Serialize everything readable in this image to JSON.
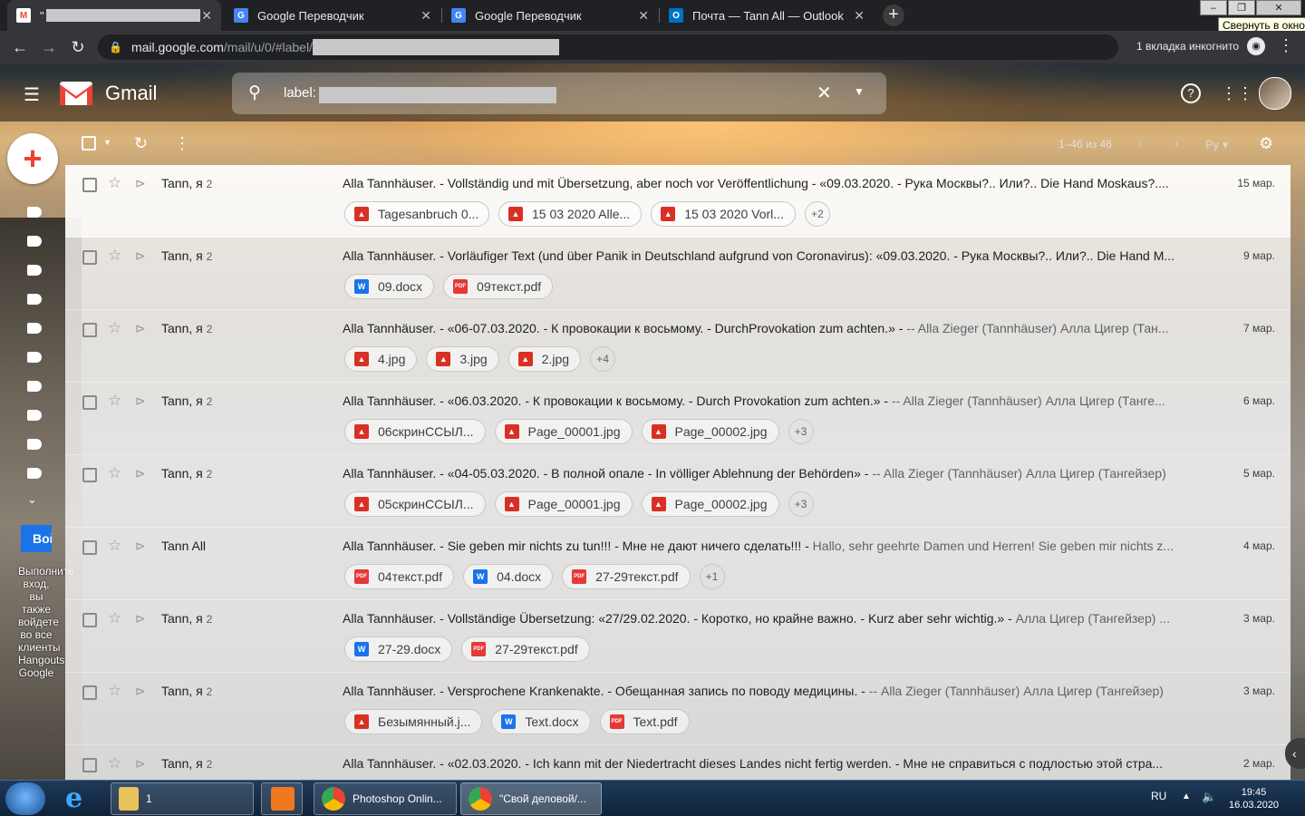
{
  "browser": {
    "tabs": [
      {
        "title": "\"",
        "redacted": true,
        "active": true,
        "favicon": "gmail-icon"
      },
      {
        "title": "Google Переводчик",
        "favicon": "google-translate-icon"
      },
      {
        "title": "Google Переводчик",
        "favicon": "google-translate-icon"
      },
      {
        "title": "Почта — Tann All — Outlook",
        "favicon": "outlook-icon"
      }
    ],
    "window_tooltip": "Свернуть в окно",
    "url_host": "mail.google.com",
    "url_path": "/mail/u/0/#label/",
    "incognito_label": "1 вкладка инкогнито"
  },
  "gmail": {
    "brand": "Gmail",
    "search_value": "label:",
    "pager_text": "1–46 из 46",
    "lang_button": "Ру",
    "hangouts": {
      "button_label": "Вой",
      "text": "Выполните вход, вы также войдете во все клиенты Hangouts Google"
    }
  },
  "emails": [
    {
      "sender": "Tann, я",
      "count": "2",
      "subject": "Alla Tannhäuser. - Vollständig und mit Übersetzung, aber noch vor Veröffentlichung - «09.03.2020. - Рука Москвы?.. Или?.. Die Hand Moskaus?....",
      "snippet": "",
      "date": "15 мар.",
      "attachments": [
        {
          "type": "img",
          "name": "Tagesanbruch 0..."
        },
        {
          "type": "img",
          "name": "15 03 2020 Alle..."
        },
        {
          "type": "img",
          "name": "15 03 2020 Vorl..."
        }
      ],
      "more": "+2"
    },
    {
      "sender": "Tann, я",
      "count": "2",
      "subject": "Alla Tannhäuser. - Vorläufiger Text (und über Panik in Deutschland aufgrund von Coronavirus): «09.03.2020. - Рука Москвы?.. Или?.. Die Hand M...",
      "snippet": "",
      "date": "9 мар.",
      "attachments": [
        {
          "type": "doc",
          "name": "09.docx"
        },
        {
          "type": "pdf",
          "name": "09текст.pdf"
        }
      ],
      "more": ""
    },
    {
      "sender": "Tann, я",
      "count": "2",
      "subject": "Alla Tannhäuser. - «06-07.03.2020. - К провокации к восьмому. - DurchProvokation zum achten.» - ",
      "snippet": "-- Alla Zieger (Tannhäuser) Алла Цигер (Тан...",
      "date": "7 мар.",
      "attachments": [
        {
          "type": "img",
          "name": "4.jpg"
        },
        {
          "type": "img",
          "name": "3.jpg"
        },
        {
          "type": "img",
          "name": "2.jpg"
        }
      ],
      "more": "+4"
    },
    {
      "sender": "Tann, я",
      "count": "2",
      "subject": "Alla Tannhäuser. - «06.03.2020. - К провокации к восьмому. - Durch Provokation zum achten.» - ",
      "snippet": "-- Alla Zieger (Tannhäuser) Алла Цигер (Танге...",
      "date": "6 мар.",
      "attachments": [
        {
          "type": "img",
          "name": "06скринССЫЛ..."
        },
        {
          "type": "img",
          "name": "Page_00001.jpg"
        },
        {
          "type": "img",
          "name": "Page_00002.jpg"
        }
      ],
      "more": "+3"
    },
    {
      "sender": "Tann, я",
      "count": "2",
      "subject": "Alla Tannhäuser. - «04-05.03.2020. - В полной опале - In völliger Ablehnung der Behörden» - ",
      "snippet": "-- Alla Zieger (Tannhäuser) Алла Цигер (Тангейзер)",
      "date": "5 мар.",
      "attachments": [
        {
          "type": "img",
          "name": "05скринССЫЛ..."
        },
        {
          "type": "img",
          "name": "Page_00001.jpg"
        },
        {
          "type": "img",
          "name": "Page_00002.jpg"
        }
      ],
      "more": "+3"
    },
    {
      "sender": "Tann All",
      "count": "",
      "subject": "Alla Tannhäuser. - Sie geben mir nichts zu tun!!! - Мне не дают ничего сделать!!! - ",
      "snippet": "Hallo, sehr geehrte Damen und Herren! Sie geben mir nichts z...",
      "date": "4 мар.",
      "attachments": [
        {
          "type": "pdf",
          "name": "04текст.pdf"
        },
        {
          "type": "doc",
          "name": "04.docx"
        },
        {
          "type": "pdf",
          "name": "27-29текст.pdf"
        }
      ],
      "more": "+1"
    },
    {
      "sender": "Tann, я",
      "count": "2",
      "subject": "Alla Tannhäuser. - Vollständige Übersetzung: «27/29.02.2020. - Коротко, но крайне важно. - Kurz aber sehr wichtig.» - ",
      "snippet": "Алла Цигер (Тангейзер) ...",
      "date": "3 мар.",
      "attachments": [
        {
          "type": "doc",
          "name": "27-29.docx"
        },
        {
          "type": "pdf",
          "name": "27-29текст.pdf"
        }
      ],
      "more": ""
    },
    {
      "sender": "Tann, я",
      "count": "2",
      "subject": "Alla Tannhäuser. - Versprochene Krankenakte. - Обещанная запись по поводу медицины. - ",
      "snippet": "-- Alla Zieger (Tannhäuser) Алла Цигер (Тангейзер)",
      "date": "3 мар.",
      "attachments": [
        {
          "type": "img",
          "name": "Безымянный.j..."
        },
        {
          "type": "doc",
          "name": "Text.docx"
        },
        {
          "type": "pdf",
          "name": "Text.pdf"
        }
      ],
      "more": ""
    },
    {
      "sender": "Tann, я",
      "count": "2",
      "subject": "Alla Tannhäuser. - «02.03.2020. - Ich kann mit der Niedertracht dieses Landes nicht fertig werden. - Мне не справиться с подлостью этой стра...",
      "snippet": "",
      "date": "2 мар.",
      "attachments": [],
      "more": ""
    }
  ],
  "taskbar": {
    "items": [
      {
        "label": "1",
        "icon": "folder-icon"
      },
      {
        "label": "",
        "icon": "media-player-icon"
      },
      {
        "label": "Photoshop Onlin...",
        "icon": "chrome-icon"
      },
      {
        "label": "\"Свой деловой/...",
        "icon": "chrome-icon"
      }
    ],
    "lang": "RU",
    "time": "19:45",
    "date": "16.03.2020"
  },
  "colors": {
    "accent": "#1a73e8",
    "gmail_red": "#ea4335",
    "tabbar": "#202124"
  }
}
